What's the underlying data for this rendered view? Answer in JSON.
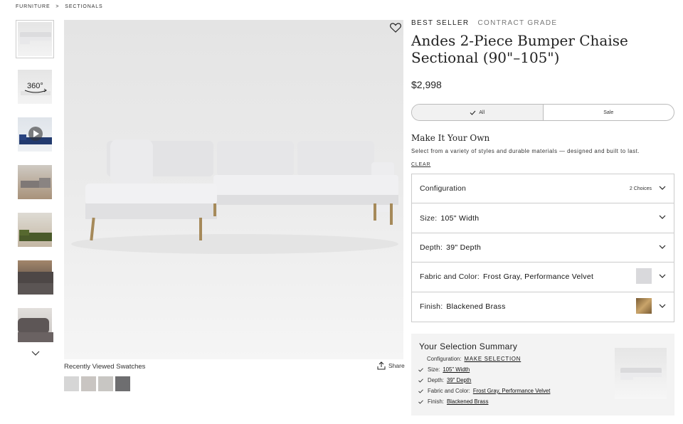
{
  "breadcrumb": {
    "item1": "FURNITURE",
    "sep": ">",
    "item2": "SECTIONALS"
  },
  "gallery": {
    "thumbnails": [
      {
        "kind": "main",
        "icon": "sofa-thumb"
      },
      {
        "kind": "360",
        "label": "360°"
      },
      {
        "kind": "video",
        "icon": "play-icon"
      },
      {
        "kind": "room-gray"
      },
      {
        "kind": "room-green"
      },
      {
        "kind": "closeup-dark"
      },
      {
        "kind": "closeup-gray"
      }
    ]
  },
  "recently_viewed": {
    "label": "Recently Viewed Swatches",
    "share_label": "Share",
    "swatch_colors": [
      "#d6d6d6",
      "#c9c5c2",
      "#c8c6c3",
      "#6e6e70"
    ]
  },
  "product": {
    "badge_primary": "BEST SELLER",
    "badge_secondary": "CONTRACT GRADE",
    "title": "Andes 2-Piece Bumper Chaise Sectional (90\"–105\")",
    "price": "$2,998",
    "filter_all": "All",
    "filter_sale": "Sale"
  },
  "customize": {
    "heading": "Make It Your Own",
    "subheading": "Select from a variety of styles and durable materials — designed and built to last.",
    "clear_label": "CLEAR",
    "options": [
      {
        "label": "Configuration",
        "value": "",
        "extra": "2 Choices"
      },
      {
        "label": "Size:",
        "value": "105\" Width"
      },
      {
        "label": "Depth:",
        "value": "39\" Depth"
      },
      {
        "label": "Fabric and Color:",
        "value": "Frost Gray, Performance Velvet",
        "swatch": "#d9d9dc"
      },
      {
        "label": "Finish:",
        "value": "Blackened Brass",
        "swatch": "#9c7a45"
      }
    ]
  },
  "summary": {
    "heading": "Your Selection Summary",
    "config_label": "Configuration:",
    "config_value": "MAKE SELECTION",
    "lines": [
      {
        "label": "Size:",
        "value": "105\" Width"
      },
      {
        "label": "Depth:",
        "value": "39\" Depth"
      },
      {
        "label": "Fabric and Color:",
        "value": "Frost Gray, Performance Velvet"
      },
      {
        "label": "Finish:",
        "value": "Blackened Brass"
      }
    ]
  },
  "colors": {
    "sofa": "#e9e9eb",
    "legs": "#a68a5a",
    "accent_text": "#222222"
  }
}
